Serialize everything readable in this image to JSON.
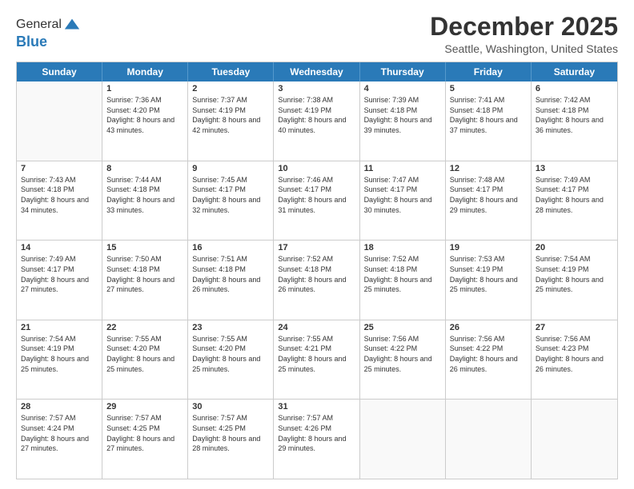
{
  "logo": {
    "general": "General",
    "blue": "Blue"
  },
  "title": "December 2025",
  "subtitle": "Seattle, Washington, United States",
  "days": [
    "Sunday",
    "Monday",
    "Tuesday",
    "Wednesday",
    "Thursday",
    "Friday",
    "Saturday"
  ],
  "weeks": [
    [
      {
        "date": "",
        "sunrise": "",
        "sunset": "",
        "daylight": ""
      },
      {
        "date": "1",
        "sunrise": "Sunrise: 7:36 AM",
        "sunset": "Sunset: 4:20 PM",
        "daylight": "Daylight: 8 hours and 43 minutes."
      },
      {
        "date": "2",
        "sunrise": "Sunrise: 7:37 AM",
        "sunset": "Sunset: 4:19 PM",
        "daylight": "Daylight: 8 hours and 42 minutes."
      },
      {
        "date": "3",
        "sunrise": "Sunrise: 7:38 AM",
        "sunset": "Sunset: 4:19 PM",
        "daylight": "Daylight: 8 hours and 40 minutes."
      },
      {
        "date": "4",
        "sunrise": "Sunrise: 7:39 AM",
        "sunset": "Sunset: 4:18 PM",
        "daylight": "Daylight: 8 hours and 39 minutes."
      },
      {
        "date": "5",
        "sunrise": "Sunrise: 7:41 AM",
        "sunset": "Sunset: 4:18 PM",
        "daylight": "Daylight: 8 hours and 37 minutes."
      },
      {
        "date": "6",
        "sunrise": "Sunrise: 7:42 AM",
        "sunset": "Sunset: 4:18 PM",
        "daylight": "Daylight: 8 hours and 36 minutes."
      }
    ],
    [
      {
        "date": "7",
        "sunrise": "Sunrise: 7:43 AM",
        "sunset": "Sunset: 4:18 PM",
        "daylight": "Daylight: 8 hours and 34 minutes."
      },
      {
        "date": "8",
        "sunrise": "Sunrise: 7:44 AM",
        "sunset": "Sunset: 4:18 PM",
        "daylight": "Daylight: 8 hours and 33 minutes."
      },
      {
        "date": "9",
        "sunrise": "Sunrise: 7:45 AM",
        "sunset": "Sunset: 4:17 PM",
        "daylight": "Daylight: 8 hours and 32 minutes."
      },
      {
        "date": "10",
        "sunrise": "Sunrise: 7:46 AM",
        "sunset": "Sunset: 4:17 PM",
        "daylight": "Daylight: 8 hours and 31 minutes."
      },
      {
        "date": "11",
        "sunrise": "Sunrise: 7:47 AM",
        "sunset": "Sunset: 4:17 PM",
        "daylight": "Daylight: 8 hours and 30 minutes."
      },
      {
        "date": "12",
        "sunrise": "Sunrise: 7:48 AM",
        "sunset": "Sunset: 4:17 PM",
        "daylight": "Daylight: 8 hours and 29 minutes."
      },
      {
        "date": "13",
        "sunrise": "Sunrise: 7:49 AM",
        "sunset": "Sunset: 4:17 PM",
        "daylight": "Daylight: 8 hours and 28 minutes."
      }
    ],
    [
      {
        "date": "14",
        "sunrise": "Sunrise: 7:49 AM",
        "sunset": "Sunset: 4:17 PM",
        "daylight": "Daylight: 8 hours and 27 minutes."
      },
      {
        "date": "15",
        "sunrise": "Sunrise: 7:50 AM",
        "sunset": "Sunset: 4:18 PM",
        "daylight": "Daylight: 8 hours and 27 minutes."
      },
      {
        "date": "16",
        "sunrise": "Sunrise: 7:51 AM",
        "sunset": "Sunset: 4:18 PM",
        "daylight": "Daylight: 8 hours and 26 minutes."
      },
      {
        "date": "17",
        "sunrise": "Sunrise: 7:52 AM",
        "sunset": "Sunset: 4:18 PM",
        "daylight": "Daylight: 8 hours and 26 minutes."
      },
      {
        "date": "18",
        "sunrise": "Sunrise: 7:52 AM",
        "sunset": "Sunset: 4:18 PM",
        "daylight": "Daylight: 8 hours and 25 minutes."
      },
      {
        "date": "19",
        "sunrise": "Sunrise: 7:53 AM",
        "sunset": "Sunset: 4:19 PM",
        "daylight": "Daylight: 8 hours and 25 minutes."
      },
      {
        "date": "20",
        "sunrise": "Sunrise: 7:54 AM",
        "sunset": "Sunset: 4:19 PM",
        "daylight": "Daylight: 8 hours and 25 minutes."
      }
    ],
    [
      {
        "date": "21",
        "sunrise": "Sunrise: 7:54 AM",
        "sunset": "Sunset: 4:19 PM",
        "daylight": "Daylight: 8 hours and 25 minutes."
      },
      {
        "date": "22",
        "sunrise": "Sunrise: 7:55 AM",
        "sunset": "Sunset: 4:20 PM",
        "daylight": "Daylight: 8 hours and 25 minutes."
      },
      {
        "date": "23",
        "sunrise": "Sunrise: 7:55 AM",
        "sunset": "Sunset: 4:20 PM",
        "daylight": "Daylight: 8 hours and 25 minutes."
      },
      {
        "date": "24",
        "sunrise": "Sunrise: 7:55 AM",
        "sunset": "Sunset: 4:21 PM",
        "daylight": "Daylight: 8 hours and 25 minutes."
      },
      {
        "date": "25",
        "sunrise": "Sunrise: 7:56 AM",
        "sunset": "Sunset: 4:22 PM",
        "daylight": "Daylight: 8 hours and 25 minutes."
      },
      {
        "date": "26",
        "sunrise": "Sunrise: 7:56 AM",
        "sunset": "Sunset: 4:22 PM",
        "daylight": "Daylight: 8 hours and 26 minutes."
      },
      {
        "date": "27",
        "sunrise": "Sunrise: 7:56 AM",
        "sunset": "Sunset: 4:23 PM",
        "daylight": "Daylight: 8 hours and 26 minutes."
      }
    ],
    [
      {
        "date": "28",
        "sunrise": "Sunrise: 7:57 AM",
        "sunset": "Sunset: 4:24 PM",
        "daylight": "Daylight: 8 hours and 27 minutes."
      },
      {
        "date": "29",
        "sunrise": "Sunrise: 7:57 AM",
        "sunset": "Sunset: 4:25 PM",
        "daylight": "Daylight: 8 hours and 27 minutes."
      },
      {
        "date": "30",
        "sunrise": "Sunrise: 7:57 AM",
        "sunset": "Sunset: 4:25 PM",
        "daylight": "Daylight: 8 hours and 28 minutes."
      },
      {
        "date": "31",
        "sunrise": "Sunrise: 7:57 AM",
        "sunset": "Sunset: 4:26 PM",
        "daylight": "Daylight: 8 hours and 29 minutes."
      },
      {
        "date": "",
        "sunrise": "",
        "sunset": "",
        "daylight": ""
      },
      {
        "date": "",
        "sunrise": "",
        "sunset": "",
        "daylight": ""
      },
      {
        "date": "",
        "sunrise": "",
        "sunset": "",
        "daylight": ""
      }
    ]
  ]
}
